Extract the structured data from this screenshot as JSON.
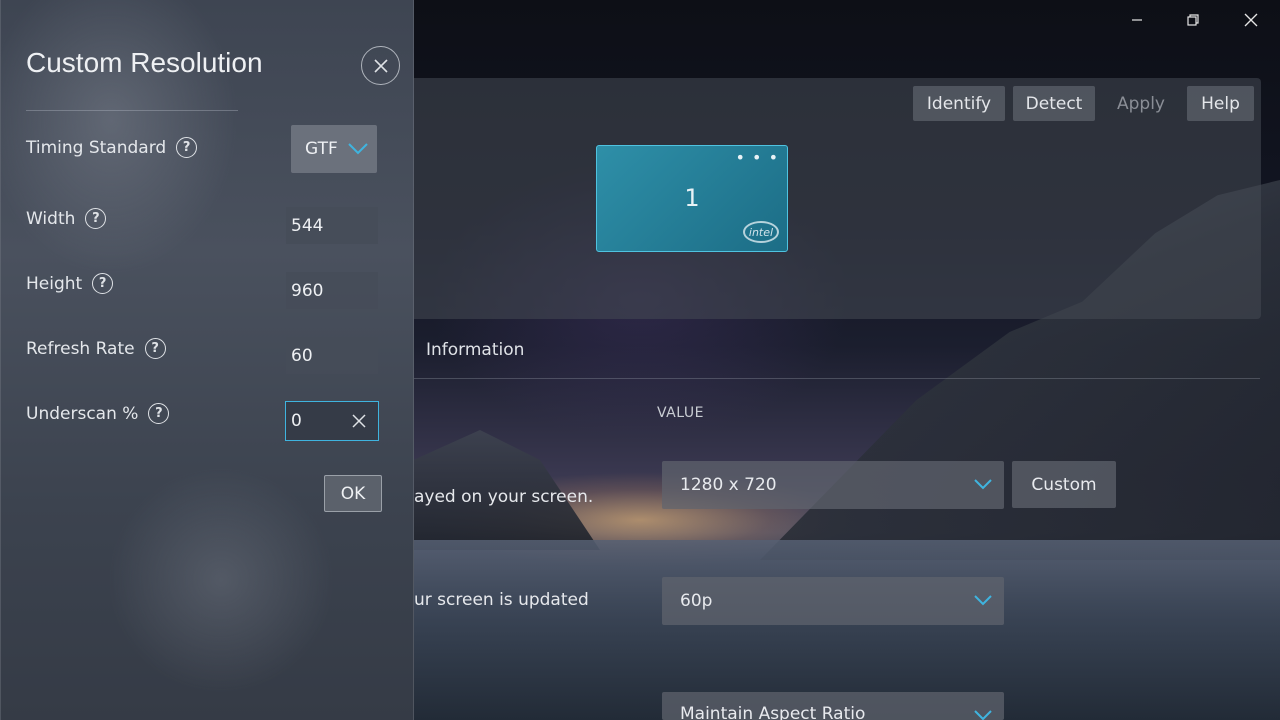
{
  "window": {
    "minimize_glyph": "—",
    "restore_glyph": "❐",
    "close_glyph": "✕"
  },
  "display": {
    "buttons": {
      "identify": "Identify",
      "detect": "Detect",
      "apply": "Apply",
      "help": "Help"
    },
    "monitor_number": "1",
    "monitor_menu": "• • •",
    "monitor_logo": "intel"
  },
  "main": {
    "tab": "Information",
    "column_header": "VALUE",
    "rows": [
      {
        "description": "ayed on your screen.",
        "value": "1280 x 720"
      },
      {
        "description": "ur screen is updated",
        "value": "60p"
      },
      {
        "description": "",
        "value": "Maintain Aspect Ratio"
      }
    ],
    "custom_button": "Custom"
  },
  "flyout": {
    "title": "Custom Resolution",
    "fields": {
      "timing_standard": {
        "label": "Timing Standard",
        "value": "GTF"
      },
      "width": {
        "label": "Width",
        "value": "544"
      },
      "height": {
        "label": "Height",
        "value": "960"
      },
      "refresh_rate": {
        "label": "Refresh Rate",
        "value": "60"
      },
      "underscan": {
        "label": "Underscan %",
        "value": "0"
      }
    },
    "ok_button": "OK",
    "help_glyph": "?"
  },
  "colors": {
    "accent": "#3fb4df",
    "chevron": "#3fb4df"
  }
}
